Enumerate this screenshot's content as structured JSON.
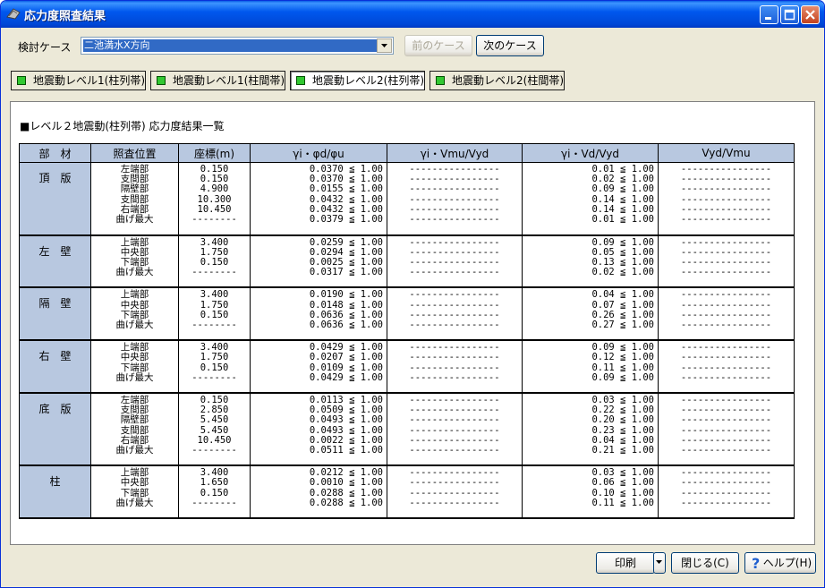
{
  "window": {
    "title": "応力度照査結果"
  },
  "toolbar": {
    "case_label": "検討ケース",
    "case_value": "二池満水X方向",
    "prev_label": "前のケース",
    "next_label": "次のケース"
  },
  "tabs": [
    {
      "label": "地震動レベル1(柱列帯)"
    },
    {
      "label": "地震動レベル1(柱間帯)"
    },
    {
      "label": "地震動レベル2(柱列帯)"
    },
    {
      "label": "地震動レベル2(柱間帯)"
    }
  ],
  "active_tab": 2,
  "heading": "■レベル２地震動(柱列帯) 応力度結果一覧",
  "table": {
    "headers": [
      "部　材",
      "照査位置",
      "座標(m)",
      "γi・φd/φu",
      "γi・Vmu/Vyd",
      "γi・Vd/Vyd",
      "Vyd/Vmu"
    ],
    "groups": [
      {
        "member": "頂　版",
        "pos": [
          "左端部",
          "支間部",
          "隔壁部",
          "支間部",
          "右端部",
          "曲げ最大"
        ],
        "coord": [
          "0.150",
          "0.150",
          "4.900",
          "10.300",
          "10.450",
          "--------"
        ],
        "phi": [
          "0.0370 ≦ 1.00",
          "0.0370 ≦ 1.00",
          "0.0155 ≦ 1.00",
          "0.0432 ≦ 1.00",
          "0.0432 ≦ 1.00",
          "0.0379 ≦ 1.00"
        ],
        "vmu": [
          "----------------",
          "----------------",
          "----------------",
          "----------------",
          "----------------",
          "----------------"
        ],
        "vd": [
          "0.01 ≦ 1.00",
          "0.02 ≦ 1.00",
          "0.09 ≦ 1.00",
          "0.14 ≦ 1.00",
          "0.14 ≦ 1.00",
          "0.01 ≦ 1.00"
        ],
        "vyd": [
          "----------------",
          "----------------",
          "----------------",
          "----------------",
          "----------------",
          "----------------"
        ]
      },
      {
        "member": "左　壁",
        "pos": [
          "上端部",
          "中央部",
          "下端部",
          "曲げ最大"
        ],
        "coord": [
          "3.400",
          "1.750",
          "0.150",
          "--------"
        ],
        "phi": [
          "0.0259 ≦ 1.00",
          "0.0294 ≦ 1.00",
          "0.0025 ≦ 1.00",
          "0.0317 ≦ 1.00"
        ],
        "vmu": [
          "----------------",
          "----------------",
          "----------------",
          "----------------"
        ],
        "vd": [
          "0.09 ≦ 1.00",
          "0.05 ≦ 1.00",
          "0.13 ≦ 1.00",
          "0.02 ≦ 1.00"
        ],
        "vyd": [
          "----------------",
          "----------------",
          "----------------",
          "----------------"
        ]
      },
      {
        "member": "隔　壁",
        "pos": [
          "上端部",
          "中央部",
          "下端部",
          "曲げ最大"
        ],
        "coord": [
          "3.400",
          "1.750",
          "0.150",
          "--------"
        ],
        "phi": [
          "0.0190 ≦ 1.00",
          "0.0148 ≦ 1.00",
          "0.0636 ≦ 1.00",
          "0.0636 ≦ 1.00"
        ],
        "vmu": [
          "----------------",
          "----------------",
          "----------------",
          "----------------"
        ],
        "vd": [
          "0.04 ≦ 1.00",
          "0.07 ≦ 1.00",
          "0.26 ≦ 1.00",
          "0.27 ≦ 1.00"
        ],
        "vyd": [
          "----------------",
          "----------------",
          "----------------",
          "----------------"
        ]
      },
      {
        "member": "右　壁",
        "pos": [
          "上端部",
          "中央部",
          "下端部",
          "曲げ最大"
        ],
        "coord": [
          "3.400",
          "1.750",
          "0.150",
          "--------"
        ],
        "phi": [
          "0.0429 ≦ 1.00",
          "0.0207 ≦ 1.00",
          "0.0109 ≦ 1.00",
          "0.0429 ≦ 1.00"
        ],
        "vmu": [
          "----------------",
          "----------------",
          "----------------",
          "----------------"
        ],
        "vd": [
          "0.09 ≦ 1.00",
          "0.12 ≦ 1.00",
          "0.11 ≦ 1.00",
          "0.09 ≦ 1.00"
        ],
        "vyd": [
          "----------------",
          "----------------",
          "----------------",
          "----------------"
        ]
      },
      {
        "member": "底　版",
        "pos": [
          "左端部",
          "支間部",
          "隔壁部",
          "支間部",
          "右端部",
          "曲げ最大"
        ],
        "coord": [
          "0.150",
          "2.850",
          "5.450",
          "5.450",
          "10.450",
          "--------"
        ],
        "phi": [
          "0.0113 ≦ 1.00",
          "0.0509 ≦ 1.00",
          "0.0493 ≦ 1.00",
          "0.0493 ≦ 1.00",
          "0.0022 ≦ 1.00",
          "0.0511 ≦ 1.00"
        ],
        "vmu": [
          "----------------",
          "----------------",
          "----------------",
          "----------------",
          "----------------",
          "----------------"
        ],
        "vd": [
          "0.03 ≦ 1.00",
          "0.22 ≦ 1.00",
          "0.20 ≦ 1.00",
          "0.23 ≦ 1.00",
          "0.04 ≦ 1.00",
          "0.21 ≦ 1.00"
        ],
        "vyd": [
          "----------------",
          "----------------",
          "----------------",
          "----------------",
          "----------------",
          "----------------"
        ]
      },
      {
        "member": "柱",
        "pos": [
          "上端部",
          "中央部",
          "下端部",
          "曲げ最大"
        ],
        "coord": [
          "3.400",
          "1.650",
          "0.150",
          "--------"
        ],
        "phi": [
          "0.0212 ≦ 1.00",
          "0.0010 ≦ 1.00",
          "0.0288 ≦ 1.00",
          "0.0288 ≦ 1.00"
        ],
        "vmu": [
          "----------------",
          "----------------",
          "----------------",
          "----------------"
        ],
        "vd": [
          "0.03 ≦ 1.00",
          "0.06 ≦ 1.00",
          "0.10 ≦ 1.00",
          "0.11 ≦ 1.00"
        ],
        "vyd": [
          "----------------",
          "----------------",
          "----------------",
          "----------------"
        ]
      }
    ]
  },
  "footer": {
    "print_label": "印刷",
    "close_label": "閉じる(C)",
    "help_label": "ヘルプ(H)"
  }
}
